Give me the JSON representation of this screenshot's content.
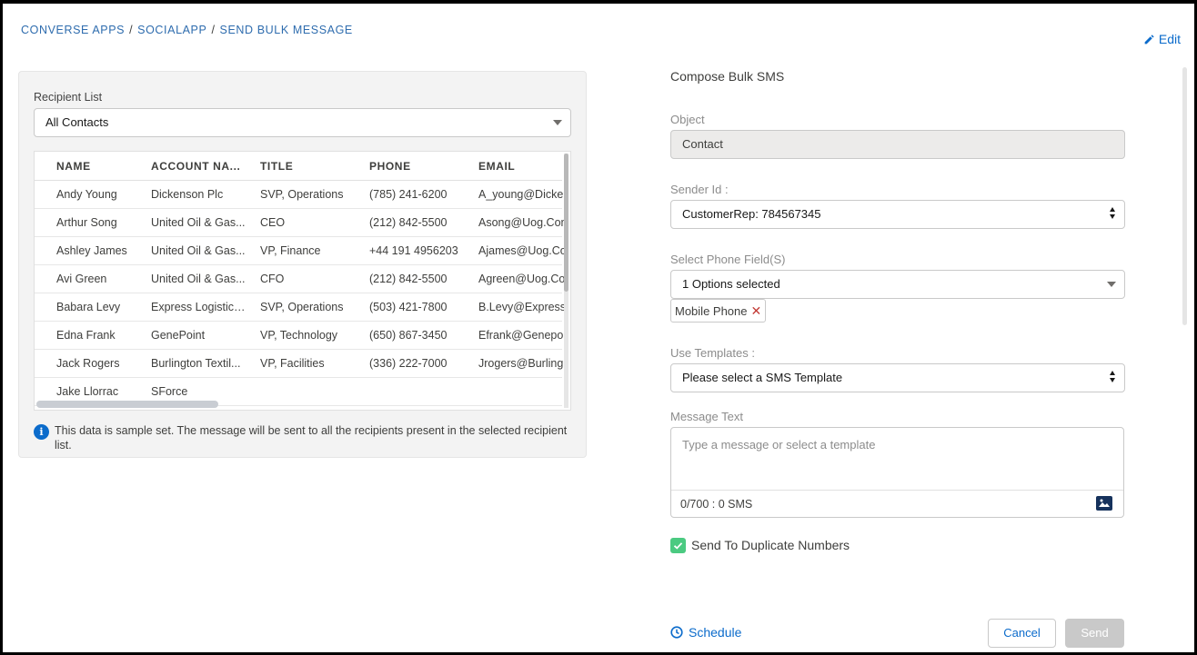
{
  "breadcrumb": [
    "CONVERSE APPS",
    "SOCIALAPP",
    "SEND BULK MESSAGE"
  ],
  "breadcrumb_separator": "/",
  "edit_label": "Edit",
  "recipient": {
    "label": "Recipient List",
    "selected": "All Contacts"
  },
  "table": {
    "columns": [
      "NAME",
      "ACCOUNT NA...",
      "TITLE",
      "PHONE",
      "EMAIL"
    ],
    "rows": [
      [
        "Andy Young",
        "Dickenson Plc",
        "SVP, Operations",
        "(785) 241-6200",
        "A_young@Dicke."
      ],
      [
        "Arthur Song",
        "United Oil & Gas...",
        "CEO",
        "(212) 842-5500",
        "Asong@Uog.Com"
      ],
      [
        "Ashley James",
        "United Oil & Gas...",
        "VP, Finance",
        "+44 191 4956203",
        "Ajames@Uog.Co."
      ],
      [
        "Avi Green",
        "United Oil & Gas...",
        "CFO",
        "(212) 842-5500",
        "Agreen@Uog.Cor"
      ],
      [
        "Babara Levy",
        "Express Logistics...",
        "SVP, Operations",
        "(503) 421-7800",
        "B.Levy@Expressl."
      ],
      [
        "Edna Frank",
        "GenePoint",
        "VP, Technology",
        "(650) 867-3450",
        "Efrank@Genepo."
      ],
      [
        "Jack Rogers",
        "Burlington Textil...",
        "VP, Facilities",
        "(336) 222-7000",
        "Jrogers@Burling."
      ],
      [
        "Jake Llorrac",
        "SForce",
        "",
        "",
        ""
      ]
    ]
  },
  "info_text": "This data is sample set. The message will be sent to all the recipients present in the selected recipient list.",
  "info_icon": "info-icon",
  "compose": {
    "title": "Compose Bulk SMS",
    "object_label": "Object",
    "object_value": "Contact",
    "sender_label": "Sender Id :",
    "sender_value": "CustomerRep: 784567345",
    "phone_label": "Select Phone Field(S)",
    "phone_value": "1 Options selected",
    "phone_pill": "Mobile Phone",
    "templates_label": "Use Templates :",
    "templates_value": "Please select a SMS Template",
    "message_label": "Message Text",
    "message_placeholder": "Type a message or select a template",
    "message_count": "0/700 : 0 SMS",
    "duplicate_label": "Send To Duplicate Numbers",
    "duplicate_checked": true,
    "schedule_label": "Schedule",
    "cancel_label": "Cancel",
    "send_label": "Send"
  },
  "colors": {
    "accent": "#0b6bcb",
    "breadcrumb": "#2e6cae",
    "checkbox": "#4bca81",
    "disabled_button": "#c9c9c9"
  }
}
